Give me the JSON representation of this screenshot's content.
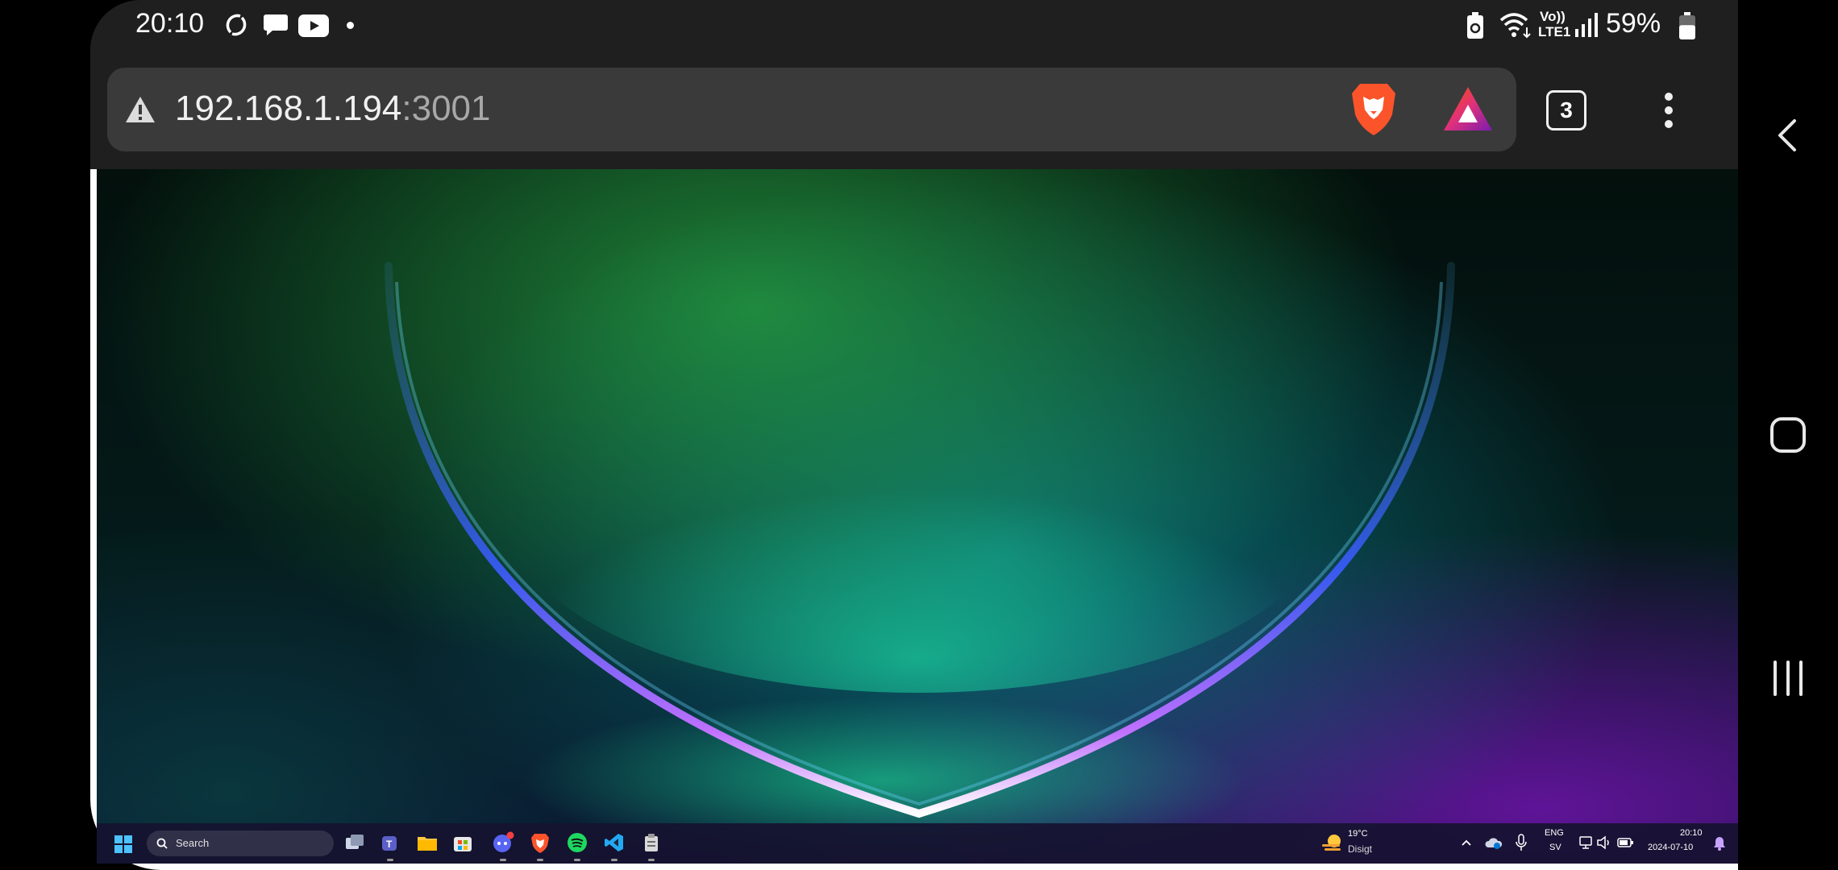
{
  "status_bar": {
    "time": "20:10",
    "network": "Vo))",
    "network_sub": "LTE1",
    "battery_percent": "59%",
    "battery_level": 0.59,
    "left_icons": [
      "sync-icon",
      "chat-icon",
      "youtube-icon",
      "dot-icon"
    ],
    "right_icons": [
      "battery-saver-icon",
      "wifi-icon",
      "signal-icon",
      "battery-icon"
    ]
  },
  "browser": {
    "security_icon": "warning-icon",
    "url_host": "192.168.1.194",
    "url_port": ":3001",
    "tab_count": "3",
    "brave_color": "#fb542b",
    "rewards_color": "#e0317b"
  },
  "taskbar": {
    "search_placeholder": "Search",
    "apps": [
      "start-icon",
      "search-icon",
      "task-view-icon",
      "teams-icon",
      "file-explorer-icon",
      "store-icon",
      "discord-icon",
      "brave-icon",
      "spotify-icon",
      "vscode-icon",
      "app-icon"
    ],
    "weather_temp": "19°C",
    "weather_desc": "Disigt",
    "lang_top": "ENG",
    "lang_bottom": "SV",
    "clock_time": "20:10",
    "clock_date": "2024-07-10"
  },
  "nav": {
    "icons": [
      "back-icon",
      "home-icon",
      "recents-icon"
    ]
  }
}
